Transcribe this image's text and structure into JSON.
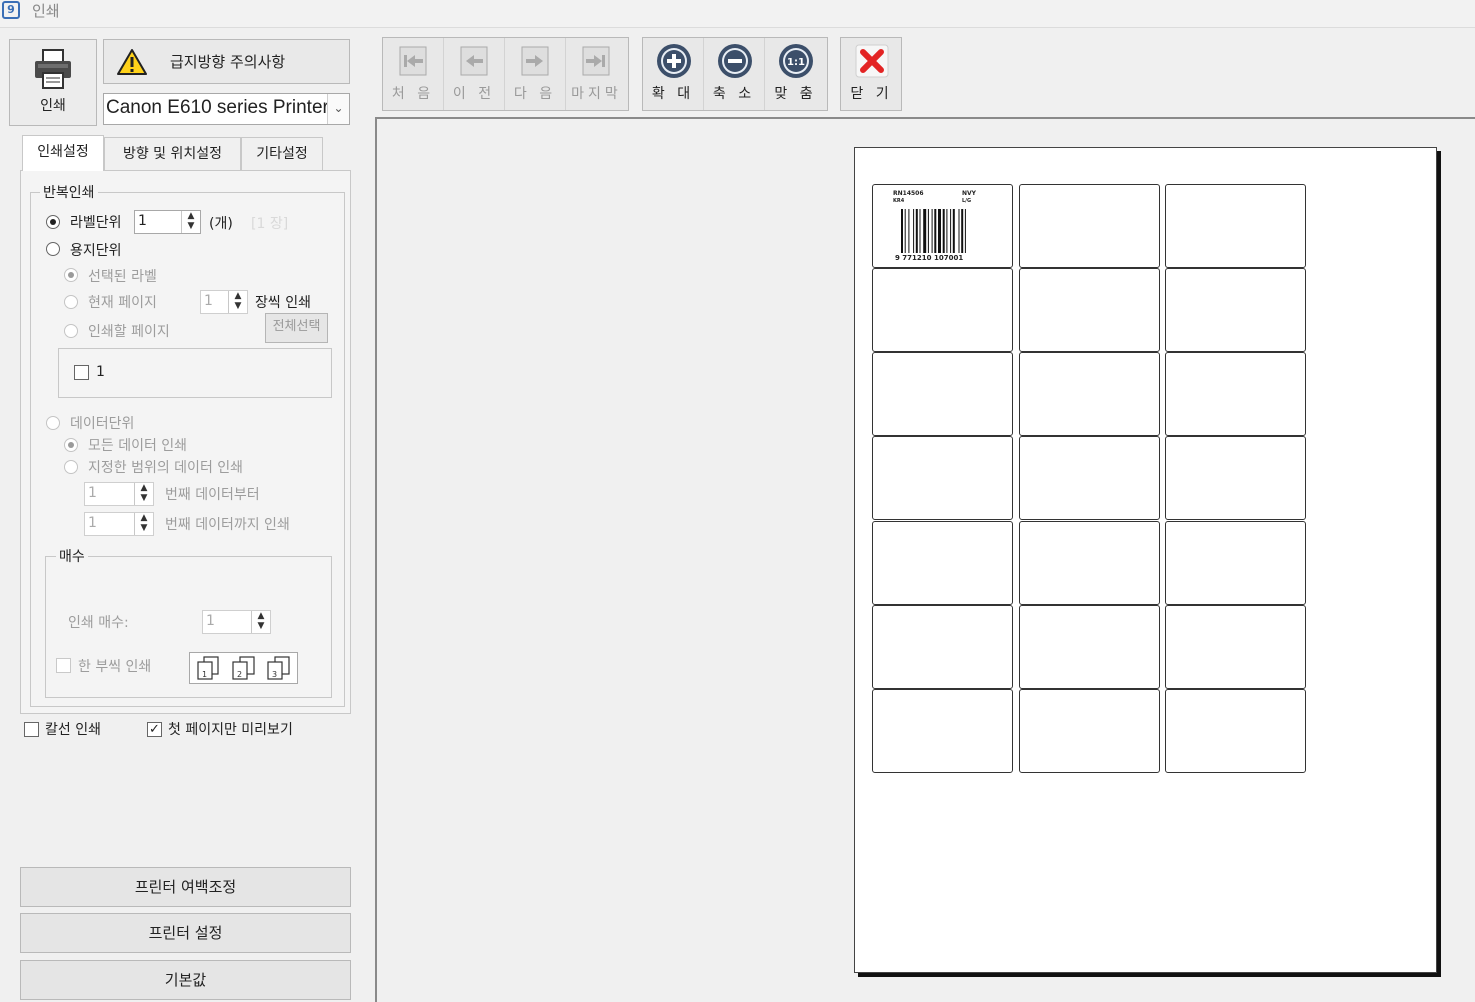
{
  "window": {
    "title": "인쇄",
    "app_icon": "9"
  },
  "print_button": {
    "label": "인쇄",
    "icon": "printer-icon"
  },
  "warning_button": {
    "label": "급지방향 주의사항",
    "icon": "warning-icon"
  },
  "printer_select": {
    "value": "Canon E610 series Printer"
  },
  "tabs": [
    {
      "label": "인쇄설정",
      "active": true
    },
    {
      "label": "방향 및 위치설정",
      "active": false
    },
    {
      "label": "기타설정",
      "active": false
    }
  ],
  "repeat_print": {
    "group_label": "반복인쇄",
    "label_unit": {
      "label": "라벨단위",
      "checked": true,
      "count": "1",
      "unit": "(개)",
      "sheets": "[1 장]"
    },
    "paper_unit": {
      "label": "용지단위",
      "checked": false,
      "selected_label": "선택된 라벨",
      "current_page": "현재 페이지",
      "pages_to_print": "인쇄할 페이지",
      "page_count": "1",
      "per_sheet_print": "장씩 인쇄",
      "select_all": "전체선택",
      "page_list": [
        "1"
      ]
    },
    "data_unit": {
      "label": "데이터단위",
      "all_data": "모든 데이터 인쇄",
      "range_data": "지정한 범위의 데이터 인쇄",
      "from_value": "1",
      "from_label": "번째 데이터부터",
      "to_value": "1",
      "to_label": "번째 데이터까지 인쇄"
    }
  },
  "copies": {
    "group_label": "매수",
    "copies_label": "인쇄 매수:",
    "copies_value": "1",
    "collate_label": "한 부씩 인쇄"
  },
  "cut_line_print": {
    "label": "칼선 인쇄",
    "checked": false
  },
  "first_page_preview": {
    "label": "첫 페이지만 미리보기",
    "checked": true
  },
  "bottom_buttons": {
    "margin": "프린터 여백조정",
    "settings": "프린터 설정",
    "defaults": "기본값"
  },
  "toolbar": {
    "first": "처 음",
    "prev": "이 전",
    "next": "다 음",
    "last": "마지막",
    "zoom_in": "확 대",
    "zoom_out": "축 소",
    "fit": "맞 춤",
    "fit_icon_text": "1:1",
    "close": "닫 기"
  },
  "preview": {
    "label_grid": {
      "rows": 7,
      "cols": 3
    },
    "first_label": {
      "line1_left": "RN14506",
      "line1_right": "NVY",
      "line2_left": "KR4",
      "line2_right": "L/G",
      "barcode_text": "9 771210 107001"
    }
  }
}
